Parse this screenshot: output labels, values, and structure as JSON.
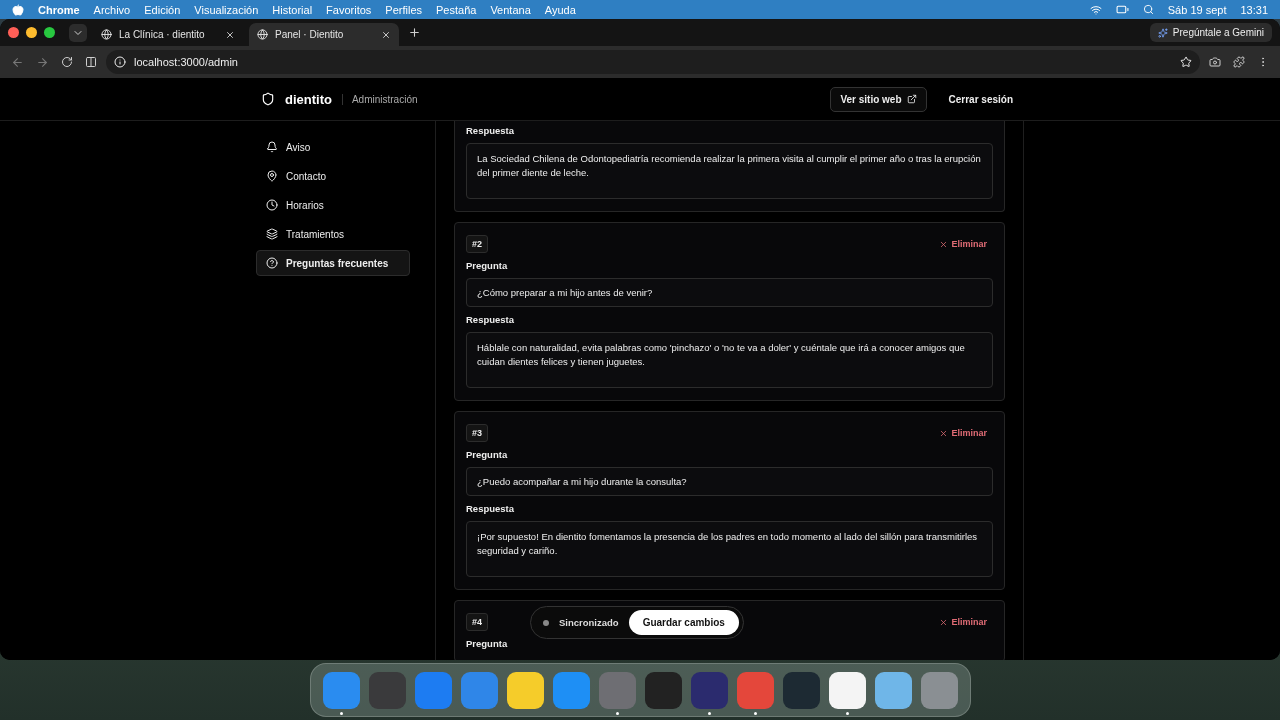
{
  "menu_bar": {
    "app": "Chrome",
    "menus": [
      "Archivo",
      "Edición",
      "Visualización",
      "Historial",
      "Favoritos",
      "Perfiles",
      "Pestaña",
      "Ventana",
      "Ayuda"
    ],
    "date": "Sáb 19 sept",
    "time": "13:31"
  },
  "browser": {
    "tabs": [
      {
        "title": "La Clínica · dientito",
        "selected": false
      },
      {
        "title": "Panel · Dientito",
        "selected": true
      }
    ],
    "gemini": "Pregúntale a Gemini",
    "url": "localhost:3000/admin"
  },
  "header": {
    "brand": "dientito",
    "section": "Administración",
    "view_site": "Ver sitio web",
    "logout": "Cerrar sesión"
  },
  "sidebar": [
    {
      "kind": "bell",
      "label": "Aviso",
      "selected": false
    },
    {
      "kind": "pin",
      "label": "Contacto",
      "selected": false
    },
    {
      "kind": "clock",
      "label": "Horarios",
      "selected": false
    },
    {
      "kind": "layers",
      "label": "Tratamientos",
      "selected": false
    },
    {
      "kind": "help",
      "label": "Preguntas frecuentes",
      "selected": true
    }
  ],
  "faqs": [
    {
      "answer_label": "Respuesta",
      "answer": "La Sociedad Chilena de Odontopediatría recomienda realizar la primera visita al cumplir el primer año o tras la erupción del primer diente de leche."
    },
    {
      "number": "#2",
      "delete": "Eliminar",
      "question_label": "Pregunta",
      "question": "¿Cómo preparar a mi hijo antes de venir?",
      "answer_label": "Respuesta",
      "answer": "Háblale con naturalidad, evita palabras como 'pinchazo' o 'no te va a doler' y cuéntale que irá a conocer amigos que cuidan dientes felices y tienen juguetes."
    },
    {
      "number": "#3",
      "delete": "Eliminar",
      "question_label": "Pregunta",
      "question": "¿Puedo acompañar a mi hijo durante la consulta?",
      "answer_label": "Respuesta",
      "answer": "¡Por supuesto! En dientito fomentamos la presencia de los padres en todo momento al lado del sillón para transmitirles seguridad y cariño."
    },
    {
      "number": "#4",
      "delete": "Eliminar",
      "question_label": "Pregunta"
    }
  ],
  "save_bar": {
    "status": "Sincronizado",
    "save": "Guardar cambios"
  },
  "dock": [
    {
      "color": "#2a8cf0",
      "running": true
    },
    {
      "color": "#3a3a3c",
      "running": false
    },
    {
      "color": "#1d7cf2",
      "running": false
    },
    {
      "color": "#2f86e8",
      "running": false
    },
    {
      "color": "#f5cc2a",
      "running": false
    },
    {
      "color": "#1e8ff5",
      "running": false
    },
    {
      "color": "#6e6e73",
      "running": true
    },
    {
      "color": "#222222",
      "running": false
    },
    {
      "color": "#2b2b6e",
      "running": true
    },
    {
      "color": "#e4473b",
      "running": true
    },
    {
      "color": "#1d2a33",
      "running": false
    },
    {
      "color": "#f4f4f4",
      "running": true
    },
    {
      "color": "#6fb6e8",
      "running": false
    },
    {
      "color": "#8a8f93",
      "running": false
    }
  ]
}
